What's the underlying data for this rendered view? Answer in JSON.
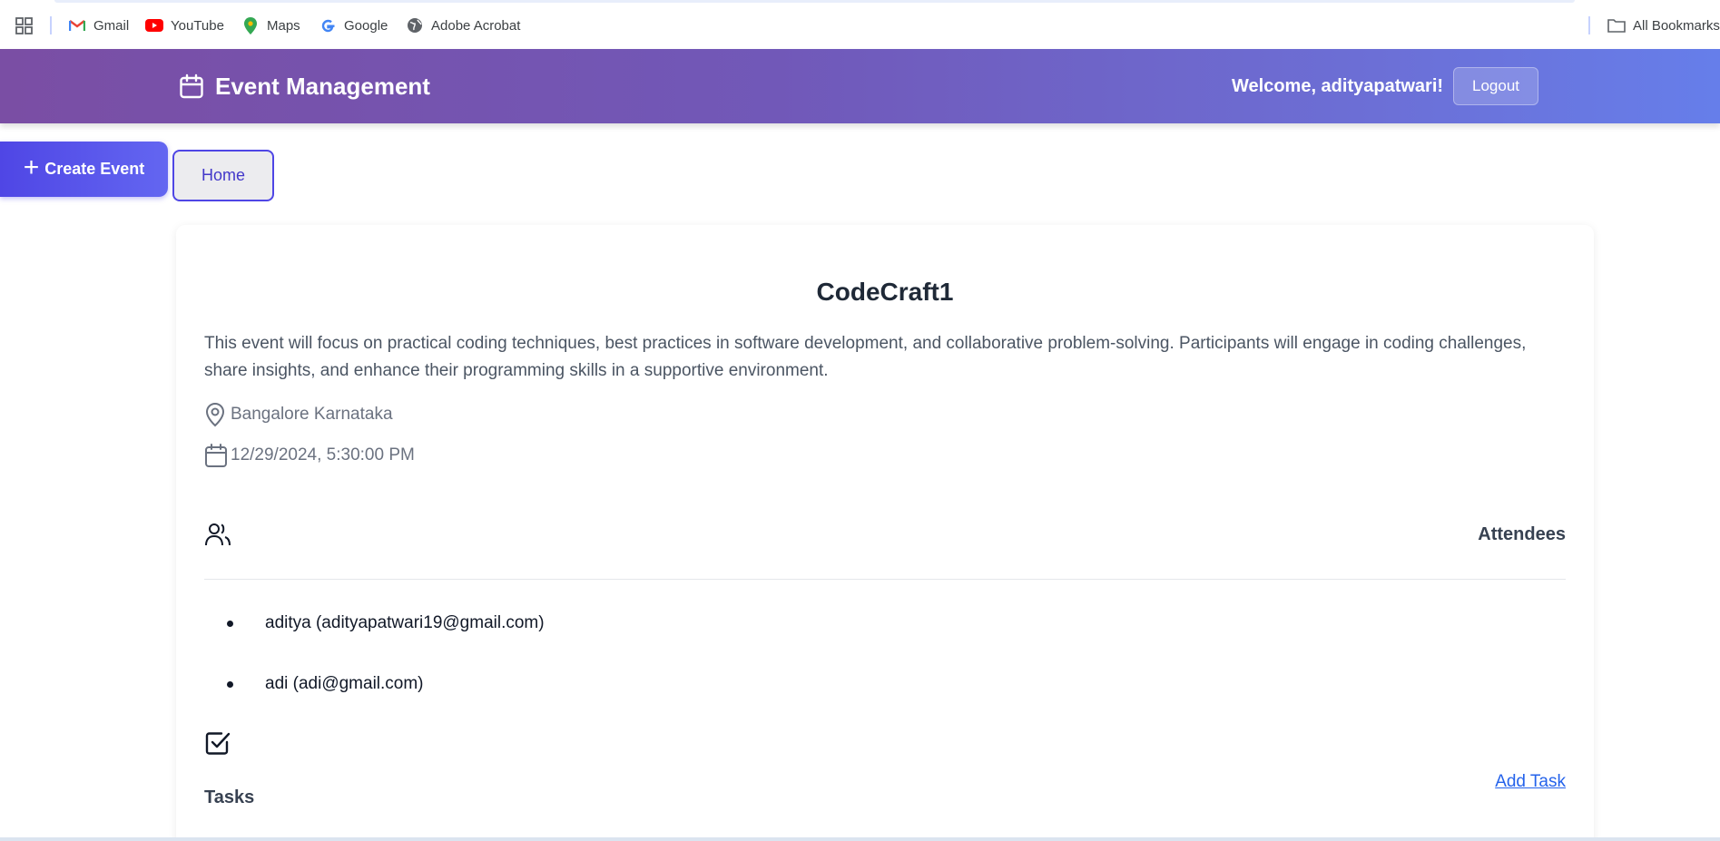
{
  "bookmarks": {
    "items": [
      {
        "label": "Gmail",
        "icon": "gmail-icon"
      },
      {
        "label": "YouTube",
        "icon": "youtube-icon"
      },
      {
        "label": "Maps",
        "icon": "maps-icon"
      },
      {
        "label": "Google",
        "icon": "google-icon"
      },
      {
        "label": "Adobe Acrobat",
        "icon": "globe-icon"
      }
    ],
    "all_bookmarks": "All Bookmarks"
  },
  "header": {
    "title": "Event Management",
    "welcome": "Welcome, adityapatwari!",
    "logout": "Logout",
    "gradient_start": "#7a4ea4",
    "gradient_end": "#667eea"
  },
  "nav": {
    "create_event": "Create Event",
    "home": "Home",
    "accent": "#4f46e5"
  },
  "event": {
    "title": "CodeCraft1",
    "description": "This event will focus on practical coding techniques, best practices in software development, and collaborative problem-solving. Participants will engage in coding challenges, share insights, and enhance their programming skills in a supportive environment.",
    "location": "Bangalore Karnataka",
    "datetime": "12/29/2024, 5:30:00 PM",
    "attendees_heading": "Attendees",
    "attendees": [
      "aditya (adityapatwari19@gmail.com)",
      "adi (adi@gmail.com)"
    ],
    "tasks_heading": "Tasks",
    "add_task": "Add Task"
  }
}
